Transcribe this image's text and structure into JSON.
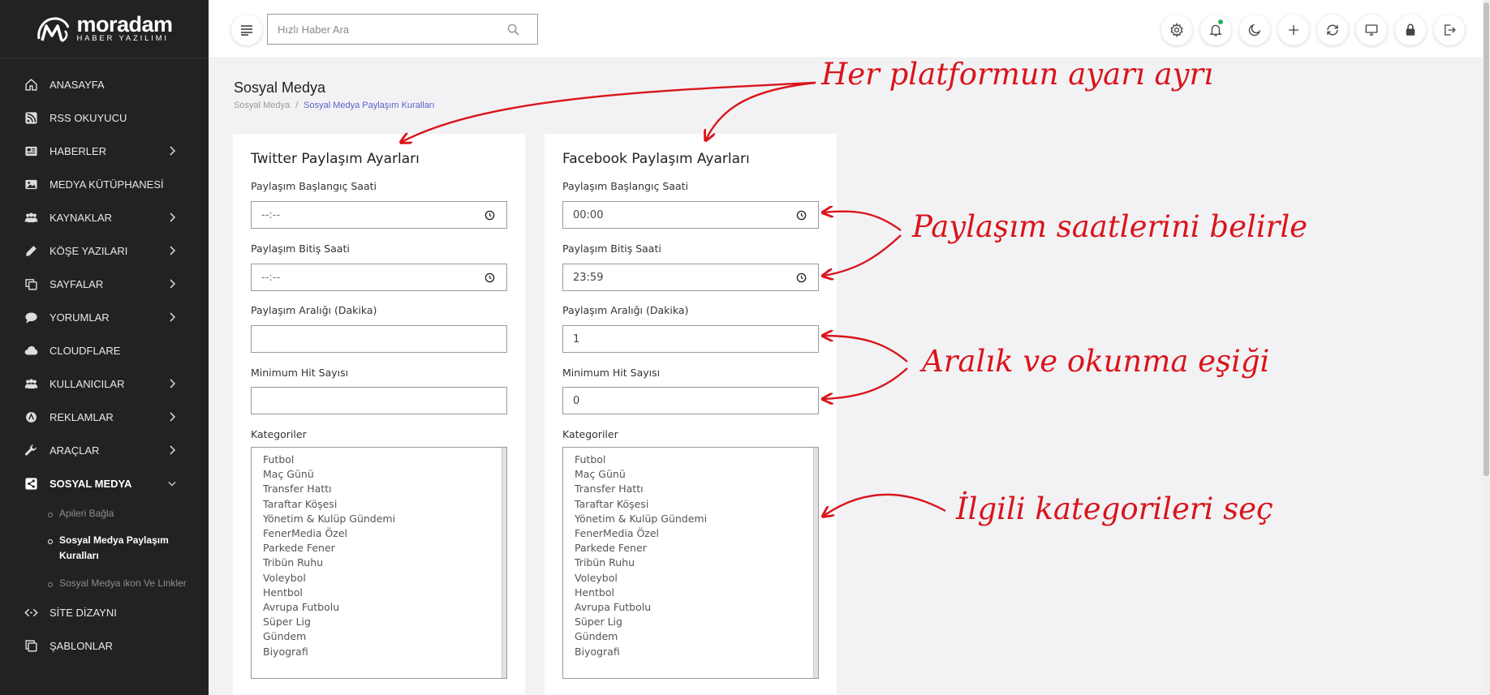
{
  "logo": {
    "name": "moradam",
    "subtitle": "HABER YAZILIMI"
  },
  "sidebar": {
    "items": [
      {
        "label": "ANASAYFA",
        "icon": "home-icon",
        "has_children": false
      },
      {
        "label": "RSS OKUYUCU",
        "icon": "rss-icon",
        "has_children": false
      },
      {
        "label": "HABERLER",
        "icon": "newspaper-icon",
        "has_children": true
      },
      {
        "label": "MEDYA KÜTÜPHANESİ",
        "icon": "image-icon",
        "has_children": false
      },
      {
        "label": "KAYNAKLAR",
        "icon": "users-icon",
        "has_children": true
      },
      {
        "label": "KÖŞE YAZILARI",
        "icon": "pen-icon",
        "has_children": true
      },
      {
        "label": "SAYFALAR",
        "icon": "copy-icon",
        "has_children": true
      },
      {
        "label": "YORUMLAR",
        "icon": "comment-icon",
        "has_children": true
      },
      {
        "label": "CLOUDFLARE",
        "icon": "cloud-icon",
        "has_children": false
      },
      {
        "label": "KULLANICILAR",
        "icon": "users-icon",
        "has_children": true
      },
      {
        "label": "REKLAMLAR",
        "icon": "ad-icon",
        "has_children": true
      },
      {
        "label": "ARAÇLAR",
        "icon": "wrench-icon",
        "has_children": true
      },
      {
        "label": "SOSYAL MEDYA",
        "icon": "share-icon",
        "has_children": true,
        "expanded": true
      },
      {
        "label": "SİTE DİZAYNI",
        "icon": "code-icon",
        "has_children": false
      },
      {
        "label": "ŞABLONLAR",
        "icon": "clone-icon",
        "has_children": false
      }
    ],
    "social_subitems": [
      {
        "label": "Apileri Bağla",
        "active": false
      },
      {
        "label": "Sosyal Medya Paylaşım Kuralları",
        "active": true
      },
      {
        "label": "Sosyal Medya ikon Ve Linkler",
        "active": false
      }
    ]
  },
  "topbar": {
    "search_placeholder": "Hızlı Haber Ara",
    "buttons": [
      "gear-icon",
      "bell-icon",
      "moon-icon",
      "plus-icon",
      "sync-icon",
      "monitor-icon",
      "lock-icon",
      "logout-icon"
    ],
    "notification_dot_color": "#1db85b"
  },
  "page": {
    "title": "Sosyal Medya",
    "breadcrumb": [
      "Sosyal Medya",
      "Sosyal Medya Paylaşım Kuralları"
    ]
  },
  "labels": {
    "start_time": "Paylaşım Başlangıç Saati",
    "end_time": "Paylaşım Bitiş Saati",
    "interval": "Paylaşım Aralığı (Dakika)",
    "min_hits": "Minimum Hit Sayısı",
    "categories": "Kategoriler"
  },
  "twitter": {
    "title": "Twitter Paylaşım Ayarları",
    "start_time": "--:--",
    "end_time": "--:--",
    "interval": "",
    "min_hits": ""
  },
  "facebook": {
    "title": "Facebook Paylaşım Ayarları",
    "start_time": "00:00",
    "end_time": "23:59",
    "interval": "1",
    "min_hits": "0"
  },
  "categories": [
    "Futbol",
    "Maç Günü",
    "Transfer Hattı",
    "Taraftar Köşesi",
    "Yönetim & Kulüp Gündemi",
    "FenerMedia Özel",
    "Parkede Fener",
    "Tribün Ruhu",
    "Voleybol",
    "Hentbol",
    "Avrupa Futbolu",
    "Süper Lig",
    "Gündem",
    "Biyografi"
  ],
  "annotations": {
    "platform": "Her platformun ayarı ayrı",
    "times": "Paylaşım saatlerini belirle",
    "interval": "Aralık ve okunma eşiği",
    "categories": "İlgili kategorileri seç",
    "color": "#d9151b"
  },
  "colors": {
    "sidebar_bg": "#222222",
    "accent": "#5b5fc7",
    "page_bg": "#f2f2f5"
  }
}
